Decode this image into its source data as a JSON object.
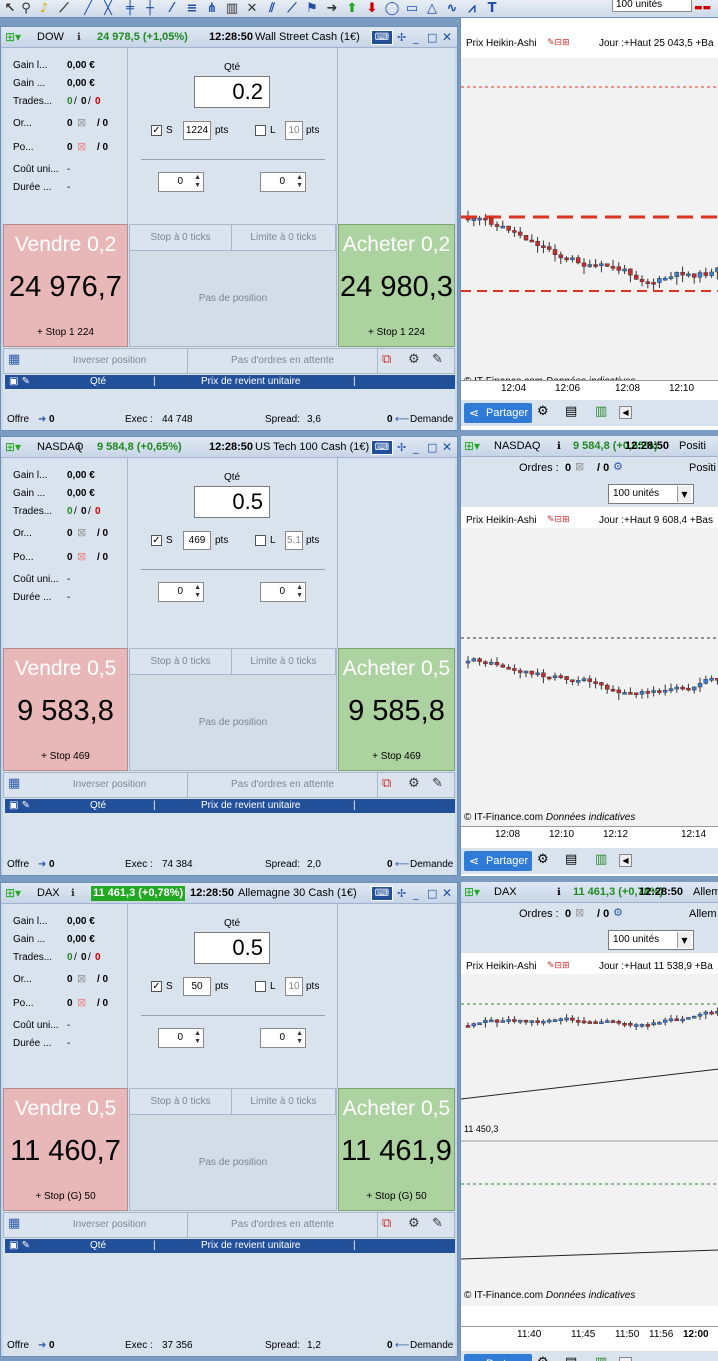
{
  "toolbar": {
    "units_select": "100 unités"
  },
  "panels": [
    {
      "instrument": "DOW",
      "quote": "24 978,5 (+1,05%)",
      "time": "12:28:50",
      "name": "Wall Street Cash (1€)",
      "stats": {
        "gain1_label": "Gain l...",
        "gain1": "0,00 €",
        "gain2_label": "Gain ...",
        "gain2": "0,00 €",
        "trades_label": "Trades...",
        "trades_a": "0",
        "trades_b": "0",
        "trades_c": "0",
        "or_label": "Or...",
        "or_a": "0",
        "or_b": "/ 0",
        "po_label": "Po...",
        "po_a": "0",
        "po_b": "/ 0",
        "cout_label": "Coût uni...",
        "cout": "-",
        "duree_label": "Durée ...",
        "duree": "-"
      },
      "qty_label": "Qté",
      "qty": "0.2",
      "s_label": "S",
      "s_value": "1224",
      "pts": "pts",
      "l_label": "L",
      "l_value": "10",
      "spin1": "0",
      "spin2": "0",
      "sell_label": "Vendre 0,2",
      "sell_price": "24 976,7",
      "sell_stop": "+ Stop 1 224",
      "buy_label": "Acheter 0,2",
      "buy_price": "24 980,3",
      "buy_stop": "+ Stop 1 224",
      "stop_ticks": "Stop à 0 ticks",
      "limit_ticks": "Limite à 0 ticks",
      "no_position": "Pas de position",
      "reverse": "Inverser position",
      "no_orders": "Pas d'ordres en attente",
      "col_qty": "Qté",
      "col_price": "Prix de revient unitaire",
      "offer_label": "Offre",
      "offer": "0",
      "exec_label": "Exec :",
      "exec": "44 748",
      "spread_label": "Spread:",
      "spread": "3,6",
      "demand": "0",
      "demand_label": "Demande"
    },
    {
      "instrument": "NASDAQ",
      "quote": "9 584,8 (+0,65%)",
      "time": "12:28:50",
      "name": "US Tech 100 Cash (1€)",
      "stats": {
        "gain1_label": "Gain l...",
        "gain1": "0,00 €",
        "gain2_label": "Gain ...",
        "gain2": "0,00 €",
        "trades_label": "Trades...",
        "trades_a": "0",
        "trades_b": "0",
        "trades_c": "0",
        "or_label": "Or...",
        "or_a": "0",
        "or_b": "/ 0",
        "po_label": "Po...",
        "po_a": "0",
        "po_b": "/ 0",
        "cout_label": "Coût uni...",
        "cout": "-",
        "duree_label": "Durée ...",
        "duree": "-"
      },
      "qty_label": "Qté",
      "qty": "0.5",
      "s_label": "S",
      "s_value": "469",
      "pts": "pts",
      "l_label": "L",
      "l_value": "5.1",
      "spin1": "0",
      "spin2": "0",
      "sell_label": "Vendre 0,5",
      "sell_price": "9 583,8",
      "sell_stop": "+ Stop 469",
      "buy_label": "Acheter 0,5",
      "buy_price": "9 585,8",
      "buy_stop": "+ Stop 469",
      "stop_ticks": "Stop à 0 ticks",
      "limit_ticks": "Limite à 0 ticks",
      "no_position": "Pas de position",
      "reverse": "Inverser position",
      "no_orders": "Pas d'ordres en attente",
      "col_qty": "Qté",
      "col_price": "Prix de revient unitaire",
      "offer_label": "Offre",
      "offer": "0",
      "exec_label": "Exec :",
      "exec": "74 384",
      "spread_label": "Spread:",
      "spread": "2,0",
      "demand": "0",
      "demand_label": "Demande"
    },
    {
      "instrument": "DAX",
      "quote": "11 461,3 (+0,78%)",
      "time": "12:28:50",
      "name": "Allemagne 30 Cash (1€)",
      "stats": {
        "gain1_label": "Gain l...",
        "gain1": "0,00 €",
        "gain2_label": "Gain ...",
        "gain2": "0,00 €",
        "trades_label": "Trades...",
        "trades_a": "0",
        "trades_b": "0",
        "trades_c": "0",
        "or_label": "Or...",
        "or_a": "0",
        "or_b": "/ 0",
        "po_label": "Po...",
        "po_a": "0",
        "po_b": "/ 0",
        "cout_label": "Coût uni...",
        "cout": "-",
        "duree_label": "Durée ...",
        "duree": "-"
      },
      "qty_label": "Qté",
      "qty": "0.5",
      "s_label": "S",
      "s_value": "50",
      "pts": "pts",
      "l_label": "L",
      "l_value": "10",
      "spin1": "0",
      "spin2": "0",
      "sell_label": "Vendre 0,5",
      "sell_price": "11 460,7",
      "sell_stop": "+ Stop (G) 50",
      "buy_label": "Acheter 0,5",
      "buy_price": "11 461,9",
      "buy_stop": "+ Stop (G) 50",
      "stop_ticks": "Stop à 0 ticks",
      "limit_ticks": "Limite à 0 ticks",
      "no_position": "Pas de position",
      "reverse": "Inverser position",
      "no_orders": "Pas d'ordres en attente",
      "col_qty": "Qté",
      "col_price": "Prix de revient unitaire",
      "offer_label": "Offre",
      "offer": "0",
      "exec_label": "Exec :",
      "exec": "37 356",
      "spread_label": "Spread:",
      "spread": "1,2",
      "demand": "0",
      "demand_label": "Demande"
    }
  ],
  "charts": [
    {
      "legend_name": "Prix Heikin-Ashi",
      "legend_info": "Jour :+Haut 25 043,5 +Ba",
      "credit_site": "© IT-Finance.com",
      "credit_note": "Données indicatives",
      "times": [
        "12:04",
        "12:06",
        "12:08",
        "12:10"
      ],
      "share": "Partager"
    },
    {
      "instrument": "NASDAQ",
      "quote": "9 584,8 (+0,65%)",
      "time": "12:28:50",
      "extra": "Positi",
      "orders_label": "Ordres :",
      "orders_a": "0",
      "orders_b": "/ 0",
      "units": "100 unités",
      "legend_name": "Prix Heikin-Ashi",
      "legend_info": "Jour :+Haut 9 608,4 +Bas",
      "credit_site": "© IT-Finance.com",
      "credit_note": "Données indicatives",
      "times": [
        "12:08",
        "12:10",
        "12:12",
        "12:14"
      ],
      "share": "Partager"
    },
    {
      "instrument": "DAX",
      "quote": "11 461,3 (+0,78%)",
      "time": "12:28:50",
      "extra": "Allem",
      "orders_label": "Ordres :",
      "orders_a": "0",
      "orders_b": "/ 0",
      "units": "100 unités",
      "legend_name": "Prix Heikin-Ashi",
      "legend_info": "Jour :+Haut 11 538,9 +Ba",
      "price_label": "11 450,3",
      "credit_site": "© IT-Finance.com",
      "credit_note": "Données indicatives",
      "times": [
        "11:40",
        "11:45",
        "11:50",
        "11:56",
        "12:00"
      ],
      "share": "Partager"
    }
  ],
  "colors": {
    "gain_green": "#1f8a1f",
    "loss_red": "#cc0000",
    "sell_bg": "#e8b7b7",
    "buy_bg": "#acd29f",
    "header_blue": "#214f9a",
    "quote_bg_dax": "#22a822"
  }
}
